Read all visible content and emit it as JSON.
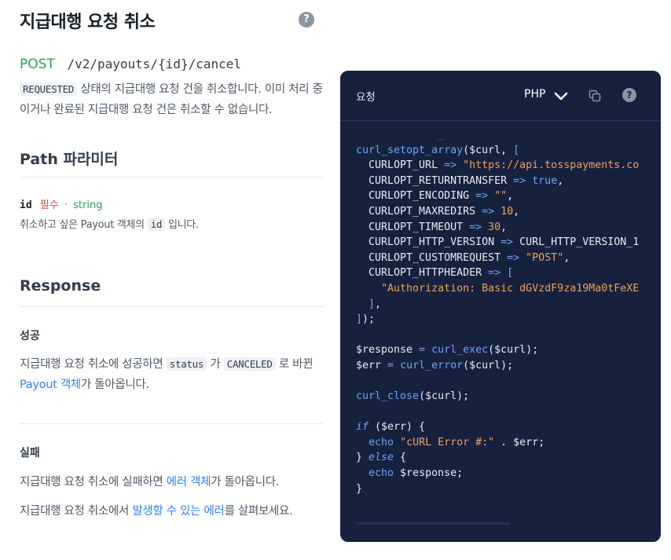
{
  "page": {
    "title": "지급대행 요청 취소",
    "help": "?"
  },
  "endpoint": {
    "method": "POST",
    "path": "/v2/payouts/{id}/cancel"
  },
  "description": {
    "badge": "REQUESTED",
    "text": " 상태의 지급대행 요청 건을 취소합니다. 이미 처리 중이거나 완료된 지급대행 요청 건은 취소할 수 없습니다."
  },
  "path_params": {
    "heading": "Path 파라미터",
    "name": "id",
    "required": "필수",
    "dot": "·",
    "type": "string",
    "desc_before": "취소하고 싶은 Payout 객체의 ",
    "desc_code": "id",
    "desc_after": " 입니다."
  },
  "response": {
    "heading": "Response",
    "success_heading": "성공",
    "success_text_1": "지급대행 요청 취소에 성공하면 ",
    "success_code_1": "status",
    "success_text_2": " 가 ",
    "success_code_2": "CANCELED",
    "success_text_3": " 로 바뀐 ",
    "success_link": "Payout 객체",
    "success_text_4": "가 돌아옵니다.",
    "fail_heading": "실패",
    "fail_text_1": "지급대행 요청 취소에 실패하면 ",
    "fail_link_1": "에러 객체",
    "fail_text_2": "가 돌아옵니다.",
    "fail_text_3": "지급대행 요청 취소에서 ",
    "fail_link_2": "발생할 수 있는 에러",
    "fail_text_4": "를 살펴보세요."
  },
  "code_panel": {
    "title": "요청",
    "language": "PHP",
    "help": "?",
    "lines": [
      "curl_setopt_array($curl, [",
      "  CURLOPT_URL => \"https://api.tosspayments.co",
      "  CURLOPT_RETURNTRANSFER => true,",
      "  CURLOPT_ENCODING => \"\",",
      "  CURLOPT_MAXREDIRS => 10,",
      "  CURLOPT_TIMEOUT => 30,",
      "  CURLOPT_HTTP_VERSION => CURL_HTTP_VERSION_1",
      "  CURLOPT_CUSTOMREQUEST => \"POST\",",
      "  CURLOPT_HTTPHEADER => [",
      "    \"Authorization: Basic dGVzdF9za19Ma0tFeXE",
      "  ],",
      "]);",
      "",
      "$response = curl_exec($curl);",
      "$err = curl_error($curl);",
      "",
      "curl_close($curl);",
      "",
      "if ($err) {",
      "  echo \"cURL Error #:\" . $err;",
      "} else {",
      "  echo $response;",
      "}"
    ]
  },
  "colors": {
    "accent_blue": "#3182f6",
    "post_green": "#2fa44a",
    "required_red": "#f04452",
    "panel_bg": "#16213e"
  }
}
